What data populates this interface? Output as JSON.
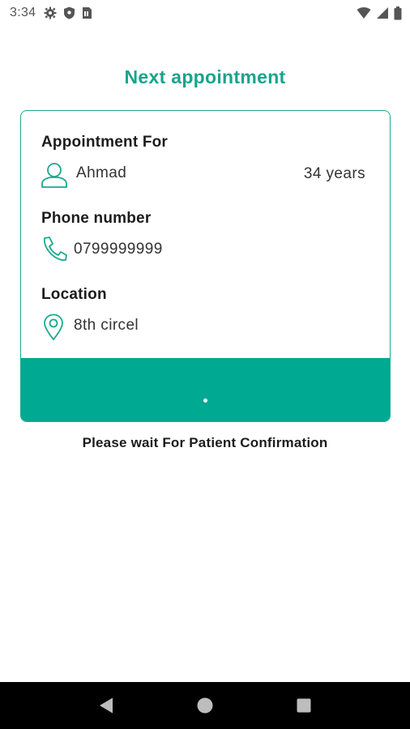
{
  "status_bar": {
    "time": "3:34",
    "left_icons": [
      "gear-icon",
      "shield-icon",
      "sim-card-icon"
    ],
    "right_icons": [
      "wifi-icon",
      "cellular-signal-icon",
      "battery-icon"
    ]
  },
  "page": {
    "title": "Next appointment",
    "wait_message": "Please wait For Patient Confirmation"
  },
  "appointment": {
    "for_label": "Appointment For",
    "patient_name": "Ahmad",
    "patient_age": "34 years",
    "phone_label": "Phone number",
    "phone": "0799999999",
    "location_label": "Location",
    "location": "8th circel"
  },
  "nav_bar": {
    "buttons": [
      "back-icon",
      "home-icon",
      "recents-icon"
    ]
  },
  "colors": {
    "accent": "#00a991",
    "title": "#16a58c",
    "nav_bg": "#000000"
  }
}
